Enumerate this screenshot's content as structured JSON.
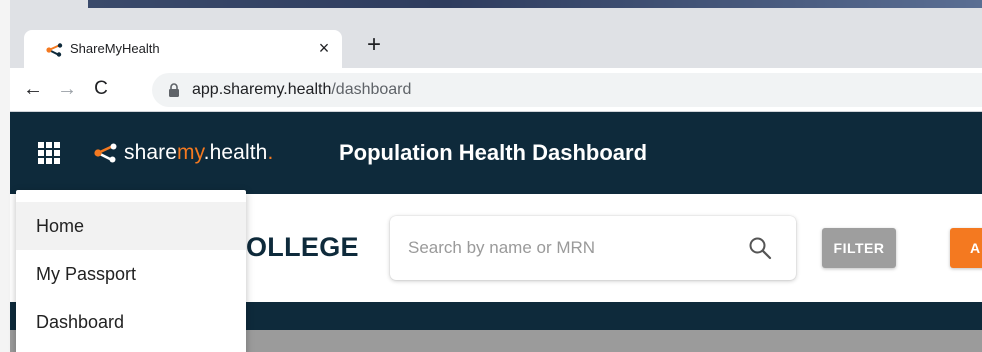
{
  "browser": {
    "tab_title": "ShareMyHealth",
    "tab_close_glyph": "×",
    "new_tab_glyph": "+",
    "back_glyph": "←",
    "forward_glyph": "→",
    "reload_glyph": "C",
    "url_host": "app.sharemy.health",
    "url_path": "/dashboard"
  },
  "header": {
    "brand_prefix": "share",
    "brand_accent": "my",
    "brand_suffix": ".health",
    "brand_dot": ".",
    "title": "Population Health Dashboard",
    "icons": [
      "apps-grid-icon",
      "sharemyhealth-logo-icon"
    ]
  },
  "content": {
    "org_name": "OLLEGE",
    "search_placeholder": "Search by name or MRN",
    "filter_label": "FILTER",
    "action_label": "A"
  },
  "menu": {
    "items": [
      {
        "label": "Home",
        "active": true
      },
      {
        "label": "My Passport",
        "active": false
      },
      {
        "label": "Dashboard",
        "active": false
      }
    ]
  },
  "colors": {
    "header_bg": "#0e2a3b",
    "accent_orange": "#f47920",
    "filter_grey": "#9e9e9e"
  }
}
